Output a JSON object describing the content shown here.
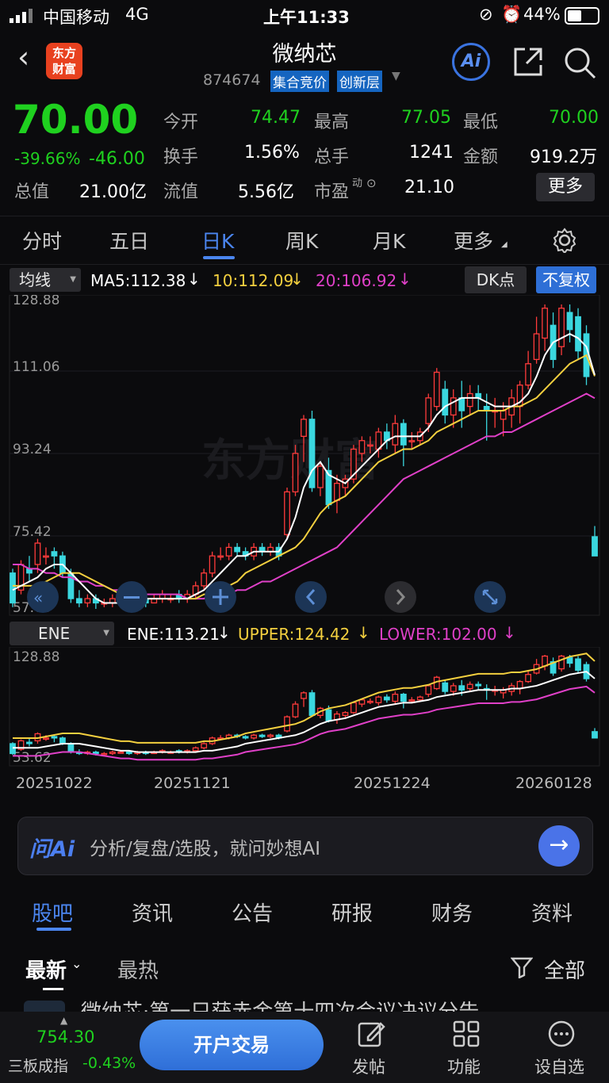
{
  "status": {
    "carrier": "中国移动",
    "network": "4G",
    "time": "上午11:33",
    "battery": "44%"
  },
  "header": {
    "title": "微纳芯",
    "code": "874674",
    "tag1": "集合竞价",
    "tag2": "创新层",
    "logo_line1": "东方",
    "logo_line2": "财富",
    "ai": "Ai"
  },
  "quote": {
    "price": "70.00",
    "pct": "-39.66%",
    "change": "-46.00",
    "open_label": "今开",
    "open": "74.47",
    "high_label": "最高",
    "high": "77.05",
    "low_label": "最低",
    "low": "70.00",
    "turnover_label": "换手",
    "turnover": "1.56%",
    "vol_label": "总手",
    "vol": "1241",
    "amount_label": "金额",
    "amount": "919.2万",
    "cap_label": "总值",
    "cap": "21.00亿",
    "float_label": "流值",
    "float": "5.56亿",
    "pe_label": "市盈",
    "pe_sup": "动",
    "pe": "21.10",
    "more": "更多"
  },
  "tabs": [
    "分时",
    "五日",
    "日K",
    "周K",
    "月K",
    "更多"
  ],
  "ma": {
    "select": "均线",
    "ma5": "MA5:112.38",
    "ma10": "10:112.09",
    "ma20": "20:106.92",
    "dk": "DK点",
    "fq": "不复权"
  },
  "ene": {
    "select": "ENE",
    "ene": "ENE:113.21",
    "upper": "UPPER:124.42",
    "lower": "LOWER:102.00"
  },
  "chart_data": {
    "type": "candlestick",
    "y_ticks_main": [
      "128.88",
      "111.06",
      "93.24",
      "75.42",
      "57.60"
    ],
    "y_ticks_ene": [
      "128.88",
      "53.62"
    ],
    "x_ticks": [
      "20251022",
      "20251121",
      "20251224",
      "20260128"
    ],
    "ylim": [
      57.6,
      128.88
    ],
    "candles": [
      [
        66,
        59,
        67,
        58
      ],
      [
        62,
        68,
        69,
        61
      ],
      [
        67,
        66,
        70,
        64
      ],
      [
        68,
        73,
        74,
        66
      ],
      [
        70,
        70,
        72,
        68
      ],
      [
        71,
        70,
        72,
        67
      ],
      [
        70,
        66,
        71,
        65
      ],
      [
        66,
        60,
        67,
        59
      ],
      [
        60,
        59,
        62,
        58
      ],
      [
        59,
        60,
        61,
        58
      ],
      [
        60,
        59,
        61,
        57.6
      ],
      [
        59,
        59,
        60,
        58
      ],
      [
        59,
        60,
        61,
        58
      ],
      [
        60,
        60,
        61,
        59
      ],
      [
        60,
        59,
        61,
        58
      ],
      [
        59,
        60,
        61,
        58
      ],
      [
        60,
        59,
        61,
        58
      ],
      [
        59,
        60,
        61,
        59
      ],
      [
        60,
        61,
        62,
        59
      ],
      [
        60,
        60,
        61,
        59
      ],
      [
        61,
        60,
        62,
        59
      ],
      [
        60,
        61,
        62,
        59
      ],
      [
        61,
        63,
        64,
        60
      ],
      [
        63,
        66,
        67,
        62
      ],
      [
        66,
        70,
        71,
        65
      ],
      [
        70,
        70,
        72,
        69
      ],
      [
        70,
        72,
        73,
        69
      ],
      [
        72,
        71,
        73,
        70
      ],
      [
        71,
        70,
        72,
        69
      ],
      [
        70,
        72,
        73,
        69
      ],
      [
        72,
        71,
        73,
        70
      ],
      [
        71,
        72,
        73,
        70
      ],
      [
        72,
        70,
        73,
        69
      ],
      [
        75,
        85,
        86,
        74
      ],
      [
        85,
        94,
        96,
        84
      ],
      [
        98,
        102,
        103,
        92
      ],
      [
        102,
        86,
        104,
        85
      ],
      [
        86,
        91,
        92,
        84
      ],
      [
        90,
        82,
        93,
        81
      ],
      [
        83,
        87,
        89,
        80
      ],
      [
        86,
        88,
        89,
        84
      ],
      [
        88,
        95,
        96,
        87
      ],
      [
        94,
        97,
        98,
        92
      ],
      [
        96,
        96,
        98,
        94
      ],
      [
        95,
        99,
        100,
        93
      ],
      [
        99,
        97,
        101,
        95
      ],
      [
        96,
        101,
        103,
        94
      ],
      [
        101,
        96,
        102,
        91
      ],
      [
        97,
        97,
        99,
        95
      ],
      [
        97,
        99,
        100,
        96
      ],
      [
        101,
        107,
        108,
        99
      ],
      [
        105,
        113,
        114,
        104
      ],
      [
        109,
        103,
        111,
        101
      ],
      [
        103,
        107,
        109,
        100
      ],
      [
        107,
        104,
        111,
        100
      ],
      [
        105,
        108,
        110,
        103
      ],
      [
        108,
        107,
        110,
        104
      ],
      [
        105,
        104,
        108,
        97
      ],
      [
        104,
        104,
        107,
        100
      ],
      [
        102,
        104,
        106,
        98
      ],
      [
        103,
        107,
        109,
        100
      ],
      [
        105,
        110,
        111,
        101
      ],
      [
        110,
        115,
        118,
        109
      ],
      [
        116,
        122,
        126,
        115
      ],
      [
        121,
        128,
        128.88,
        118
      ],
      [
        124,
        116,
        127,
        114
      ],
      [
        119,
        128,
        128.88,
        117
      ],
      [
        127,
        123,
        128.88,
        120
      ],
      [
        126,
        118,
        128,
        116
      ],
      [
        122,
        112,
        124,
        110
      ],
      [
        74.5,
        70,
        77,
        70
      ]
    ],
    "ma5": [
      62,
      63,
      64,
      65,
      67,
      68,
      68,
      66,
      64,
      62,
      60,
      59,
      59,
      59,
      60,
      60,
      60,
      60,
      60,
      60,
      60,
      60,
      61,
      62,
      64,
      66,
      68,
      70,
      70,
      71,
      71,
      71,
      71,
      74,
      79,
      86,
      90,
      92,
      89,
      88,
      87,
      89,
      91,
      93,
      95,
      97,
      98,
      98,
      98,
      98,
      100,
      103,
      105,
      106,
      107,
      107,
      107,
      106,
      105,
      105,
      105,
      106,
      108,
      112,
      117,
      120,
      121,
      122,
      121,
      119,
      112.38
    ],
    "ma10": [
      63,
      63,
      63,
      63,
      64,
      65,
      66,
      66,
      66,
      65,
      64,
      63,
      62,
      61,
      61,
      60,
      60,
      60,
      60,
      60,
      60,
      60,
      60,
      61,
      61,
      62,
      63,
      64,
      66,
      67,
      68,
      69,
      70,
      71,
      72,
      74,
      77,
      80,
      82,
      83,
      84,
      86,
      88,
      90,
      92,
      93,
      94,
      95,
      95,
      96,
      97,
      99,
      100,
      101,
      102,
      103,
      104,
      104,
      104,
      104,
      105,
      105,
      106,
      107,
      109,
      111,
      113,
      115,
      116,
      117,
      112.09
    ],
    "ma20": [
      68,
      68,
      67,
      67,
      66,
      66,
      65,
      65,
      64,
      64,
      63,
      63,
      62,
      62,
      62,
      61,
      61,
      61,
      61,
      61,
      61,
      60,
      60,
      60,
      61,
      61,
      61,
      62,
      62,
      63,
      64,
      64,
      65,
      66,
      67,
      68,
      69,
      70,
      71,
      72,
      74,
      76,
      78,
      80,
      82,
      84,
      86,
      88,
      89,
      90,
      91,
      92,
      93,
      94,
      95,
      96,
      97,
      98,
      98,
      99,
      99,
      100,
      101,
      102,
      103,
      104,
      105,
      106,
      107,
      108,
      106.92
    ]
  },
  "ai_search": {
    "logo": "问Ai",
    "placeholder": "分析/复盘/选股，就问妙想AI"
  },
  "sub_tabs": [
    "股吧",
    "资讯",
    "公告",
    "研报",
    "财务",
    "资料"
  ],
  "filters": {
    "latest": "最新",
    "hot": "最热",
    "all": "全部"
  },
  "post_preview": "微纳芯·第一只获赤金第十四次会议决议分告",
  "bottom": {
    "index_value": "754.30",
    "index_name": "三板成指",
    "index_pct": "-0.43%",
    "trade": "开户交易",
    "post": "发帖",
    "func": "功能",
    "watch": "设自选"
  }
}
